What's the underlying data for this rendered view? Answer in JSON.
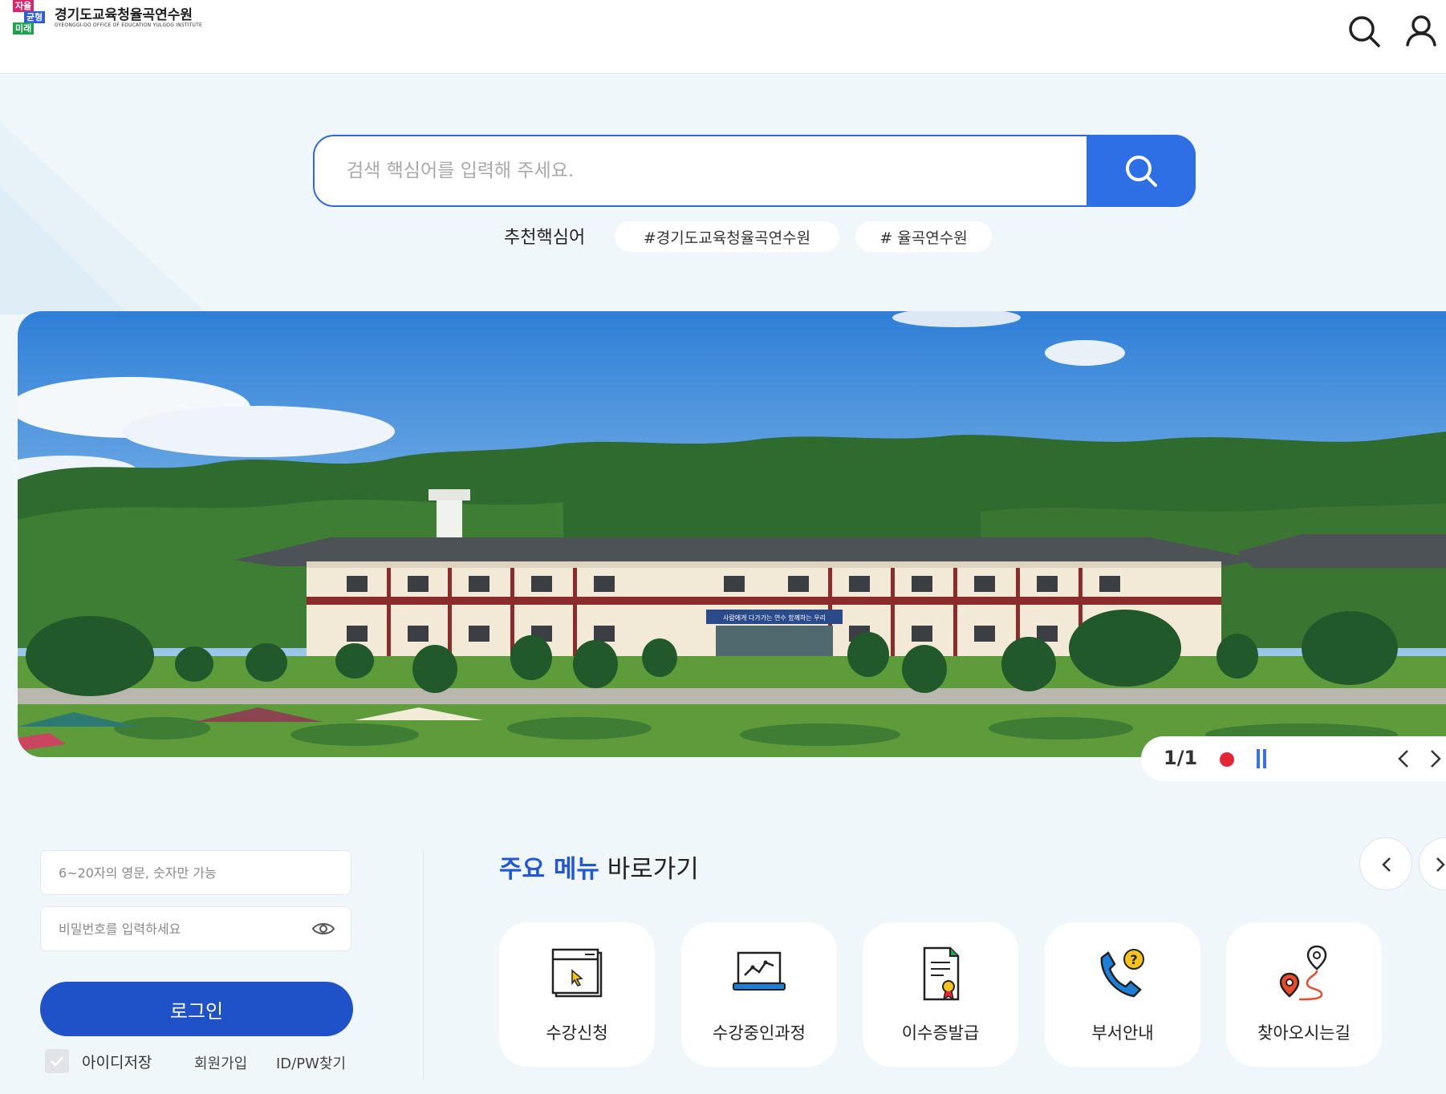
{
  "header": {
    "logo_mark": [
      "자율",
      "균형",
      "미래"
    ],
    "logo_title": "경기도교육청율곡연수원",
    "logo_subtitle": "GYEONGGI-DO OFFICE OF EDUCATION YULGOG INSTITUTE"
  },
  "search": {
    "placeholder": "검색 핵심어를 입력해 주세요.",
    "recommended_label": "추천핵심어",
    "keywords": [
      "#경기도교육청율곡연수원",
      "# 율곡연수원"
    ]
  },
  "banner": {
    "sign_text": "사람에게 다가가는 연수 함께하는 우리",
    "slide_count": "1/1"
  },
  "login": {
    "id_placeholder": "6~20자의 영문, 숫자만 가능",
    "pw_placeholder": "비밀번호를 입력하세요",
    "button": "로그인",
    "save_id": "아이디저장",
    "join": "회원가입",
    "find": "ID/PW찾기"
  },
  "quick_menu": {
    "title_highlight": "주요 메뉴",
    "title_rest": " 바로가기",
    "items": [
      {
        "label": "수강신청",
        "icon": "course-apply-icon"
      },
      {
        "label": "수강중인과정",
        "icon": "course-progress-icon"
      },
      {
        "label": "이수증발급",
        "icon": "certificate-icon"
      },
      {
        "label": "부서안내",
        "icon": "department-phone-icon"
      },
      {
        "label": "찾아오시는길",
        "icon": "directions-icon"
      }
    ]
  },
  "colors": {
    "primary": "#2e6fe6",
    "login_button": "#1f52c9",
    "highlight": "#2357d4",
    "background": "#eff7fb"
  }
}
